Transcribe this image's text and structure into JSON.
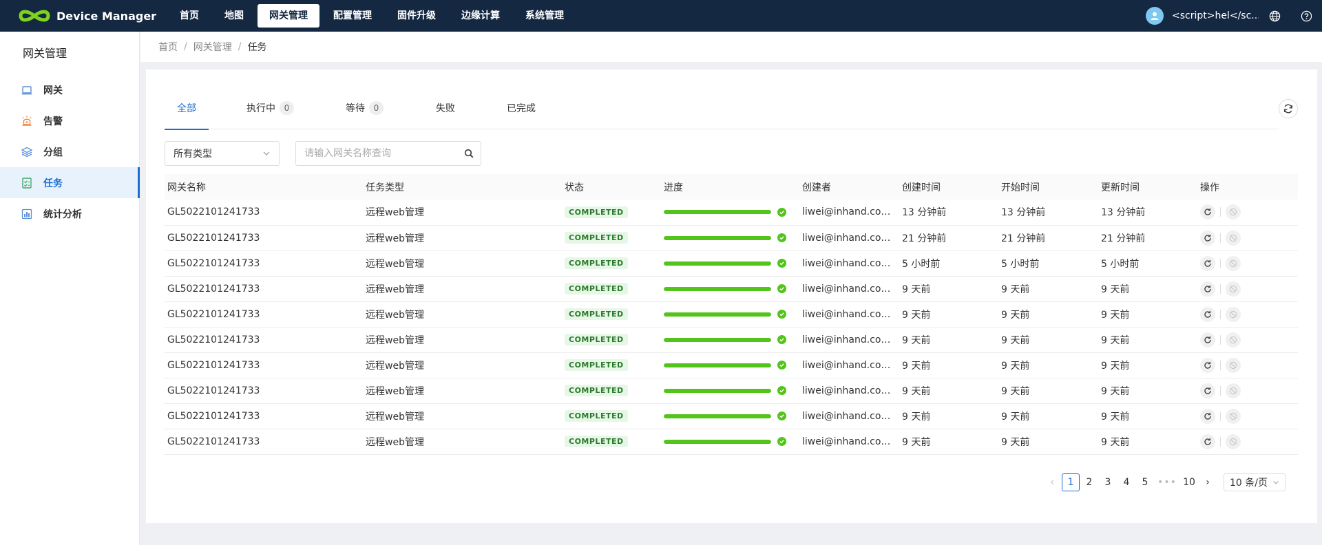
{
  "app": {
    "name": "Device Manager",
    "nav": [
      {
        "label": "首页"
      },
      {
        "label": "地图"
      },
      {
        "label": "网关管理",
        "active": true
      },
      {
        "label": "配置管理"
      },
      {
        "label": "固件升级"
      },
      {
        "label": "边缘计算"
      },
      {
        "label": "系统管理"
      }
    ],
    "username": "<script>hel</sc...",
    "icons": {
      "language": "globe-icon",
      "help": "question-icon"
    },
    "colors": {
      "topbar": "#142842",
      "accent": "#1c6dd0",
      "success": "#52c41a"
    }
  },
  "sidebar": {
    "title": "网关管理",
    "items": [
      {
        "label": "网关",
        "icon": "gateway-icon"
      },
      {
        "label": "告警",
        "icon": "alarm-icon"
      },
      {
        "label": "分组",
        "icon": "layers-icon"
      },
      {
        "label": "任务",
        "icon": "task-icon",
        "active": true
      },
      {
        "label": "统计分析",
        "icon": "chart-icon"
      }
    ]
  },
  "breadcrumb": {
    "items": [
      "首页",
      "网关管理",
      "任务"
    ]
  },
  "tabs": [
    {
      "label": "全部",
      "active": true
    },
    {
      "label": "执行中",
      "count": "0"
    },
    {
      "label": "等待",
      "count": "0"
    },
    {
      "label": "失败"
    },
    {
      "label": "已完成"
    }
  ],
  "filters": {
    "type_value": "所有类型",
    "search_placeholder": "请输入网关名称查询"
  },
  "table": {
    "columns": [
      "网关名称",
      "任务类型",
      "状态",
      "进度",
      "创建者",
      "创建时间",
      "开始时间",
      "更新时间",
      "操作"
    ],
    "rows": [
      {
        "name": "GL5022101241733",
        "type": "远程web管理",
        "status": "COMPLETED",
        "progress": 100,
        "creator": "liwei@inhand.com.cn",
        "created": "13 分钟前",
        "started": "13 分钟前",
        "updated": "13 分钟前"
      },
      {
        "name": "GL5022101241733",
        "type": "远程web管理",
        "status": "COMPLETED",
        "progress": 100,
        "creator": "liwei@inhand.com.cn",
        "created": "21 分钟前",
        "started": "21 分钟前",
        "updated": "21 分钟前"
      },
      {
        "name": "GL5022101241733",
        "type": "远程web管理",
        "status": "COMPLETED",
        "progress": 100,
        "creator": "liwei@inhand.com.cn",
        "created": "5 小时前",
        "started": "5 小时前",
        "updated": "5 小时前"
      },
      {
        "name": "GL5022101241733",
        "type": "远程web管理",
        "status": "COMPLETED",
        "progress": 100,
        "creator": "liwei@inhand.com.cn",
        "created": "9 天前",
        "started": "9 天前",
        "updated": "9 天前"
      },
      {
        "name": "GL5022101241733",
        "type": "远程web管理",
        "status": "COMPLETED",
        "progress": 100,
        "creator": "liwei@inhand.com.cn",
        "created": "9 天前",
        "started": "9 天前",
        "updated": "9 天前"
      },
      {
        "name": "GL5022101241733",
        "type": "远程web管理",
        "status": "COMPLETED",
        "progress": 100,
        "creator": "liwei@inhand.com.cn",
        "created": "9 天前",
        "started": "9 天前",
        "updated": "9 天前"
      },
      {
        "name": "GL5022101241733",
        "type": "远程web管理",
        "status": "COMPLETED",
        "progress": 100,
        "creator": "liwei@inhand.com.cn",
        "created": "9 天前",
        "started": "9 天前",
        "updated": "9 天前"
      },
      {
        "name": "GL5022101241733",
        "type": "远程web管理",
        "status": "COMPLETED",
        "progress": 100,
        "creator": "liwei@inhand.com.cn",
        "created": "9 天前",
        "started": "9 天前",
        "updated": "9 天前"
      },
      {
        "name": "GL5022101241733",
        "type": "远程web管理",
        "status": "COMPLETED",
        "progress": 100,
        "creator": "liwei@inhand.com.cn",
        "created": "9 天前",
        "started": "9 天前",
        "updated": "9 天前"
      },
      {
        "name": "GL5022101241733",
        "type": "远程web管理",
        "status": "COMPLETED",
        "progress": 100,
        "creator": "liwei@inhand.com.cn",
        "created": "9 天前",
        "started": "9 天前",
        "updated": "9 天前"
      }
    ]
  },
  "pagination": {
    "pages": [
      "1",
      "2",
      "3",
      "4",
      "5"
    ],
    "ellipsis": "•••",
    "last": "10",
    "current": "1",
    "page_size": "10 条/页"
  }
}
